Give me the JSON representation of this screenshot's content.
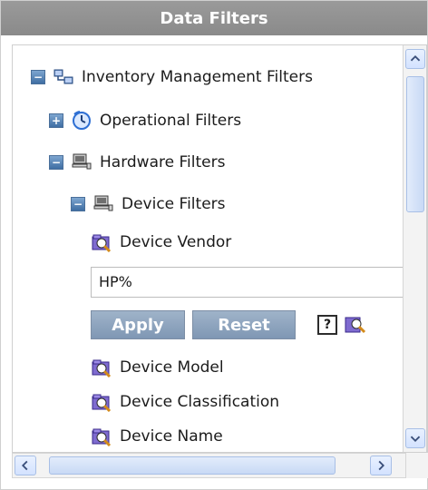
{
  "panel": {
    "title": "Data Filters"
  },
  "tree": {
    "inventory_label": "Inventory Management Filters",
    "operational_label": "Operational Filters",
    "hardware_label": "Hardware Filters",
    "device_filters_label": "Device Filters",
    "device_vendor_label": "Device Vendor",
    "device_model_label": "Device Model",
    "device_classification_label": "Device Classification",
    "device_name_label": "Device Name"
  },
  "filter": {
    "value": "HP%",
    "apply_label": "Apply",
    "reset_label": "Reset",
    "help_label": "?"
  },
  "icons": {
    "expand": "plus-toggle",
    "collapse": "minus-toggle",
    "network": "network-icon",
    "clock": "clock-icon",
    "computer": "computer-icon",
    "folder_search": "folder-search-icon"
  }
}
